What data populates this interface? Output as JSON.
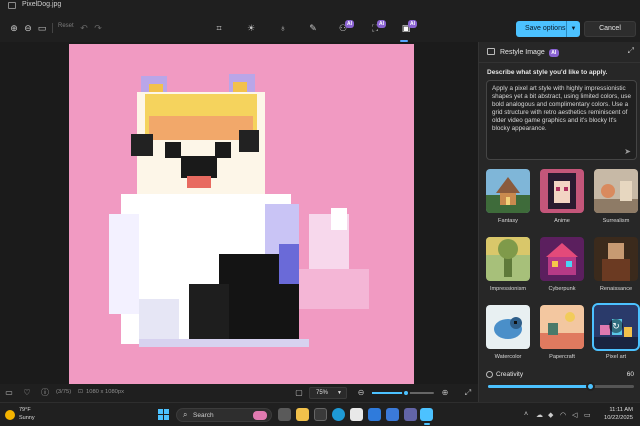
{
  "window": {
    "title": "PixelDog.jpg"
  },
  "toolbar": {
    "reset_label": "Reset",
    "save_label": "Save options",
    "cancel_label": "Cancel",
    "ai_badge": "AI"
  },
  "panel": {
    "title": "Restyle Image",
    "badge": "AI",
    "prompt_label": "Describe what style you'd like to apply.",
    "prompt_text": "Apply a pixel art style with highly impressionistic shapes yet a bit abstract, using limited colors, use bold analogous and complimentary colors. Use a grid structure with retro aesthetics reminiscent of older video game graphics and it's blocky It's blocky appearance.",
    "styles": [
      {
        "label": "Fantasy",
        "selected": false
      },
      {
        "label": "Anime",
        "selected": false
      },
      {
        "label": "Surrealism",
        "selected": false
      },
      {
        "label": "Impressionism",
        "selected": false
      },
      {
        "label": "Cyberpunk",
        "selected": false
      },
      {
        "label": "Renaissance",
        "selected": false
      },
      {
        "label": "Watercolor",
        "selected": false
      },
      {
        "label": "Papercraft",
        "selected": false
      },
      {
        "label": "Pixel art",
        "selected": true
      }
    ],
    "creativity_label": "Creativity",
    "creativity_value": "60",
    "creativity_fraction": 0.7
  },
  "statusbar": {
    "page_counter": "(3/75)",
    "dimensions": "1080 x 1080px",
    "zoom_value": "75%",
    "zoom_fraction": 0.55
  },
  "taskbar": {
    "weather_temp": "79°F",
    "weather_condition": "Sunny",
    "search_placeholder": "Search",
    "time": "11:11 AM",
    "date": "10/22/2025"
  },
  "colors": {
    "accent": "#4cc2ff",
    "canvas_bg": "#f19ac2",
    "ai_purple": "#8a63d2"
  }
}
